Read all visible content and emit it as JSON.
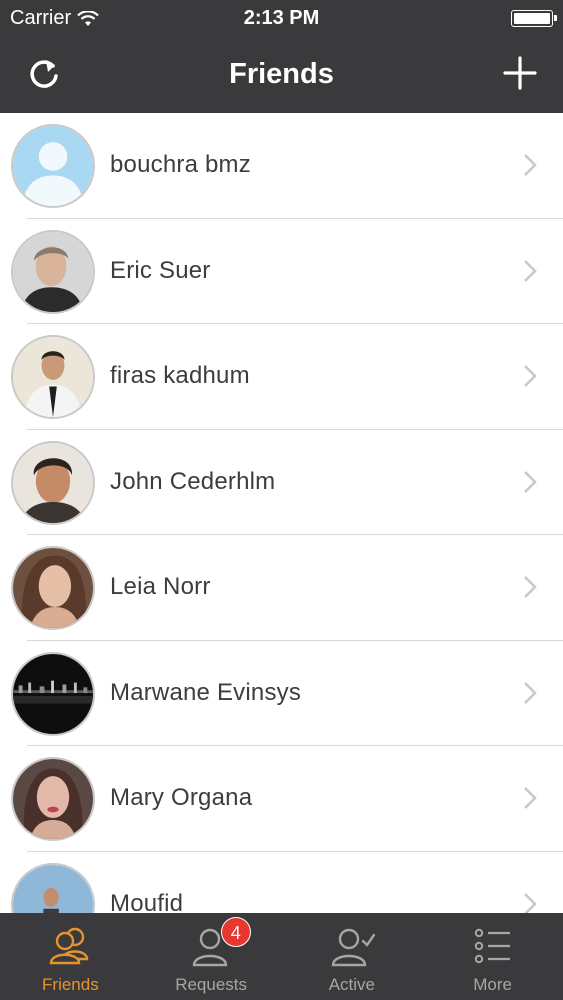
{
  "status_bar": {
    "carrier": "Carrier",
    "time": "2:13 PM"
  },
  "nav": {
    "title": "Friends",
    "left_icon": "refresh-icon",
    "right_icon": "plus-icon"
  },
  "friends": [
    {
      "name": "bouchra bmz"
    },
    {
      "name": "Eric Suer"
    },
    {
      "name": "firas kadhum"
    },
    {
      "name": "John Cederhlm"
    },
    {
      "name": "Leia Norr"
    },
    {
      "name": "Marwane Evinsys"
    },
    {
      "name": "Mary Organa"
    },
    {
      "name": "Moufid"
    }
  ],
  "tabs": [
    {
      "label": "Friends",
      "icon": "friends-icon",
      "active": true
    },
    {
      "label": "Requests",
      "icon": "requests-icon",
      "badge": "4"
    },
    {
      "label": "Active",
      "icon": "active-icon"
    },
    {
      "label": "More",
      "icon": "more-icon"
    }
  ],
  "colors": {
    "bar": "#3a3a3c",
    "accent": "#e8922e",
    "badge": "#e8372f",
    "inactive": "#a6a6a6"
  }
}
